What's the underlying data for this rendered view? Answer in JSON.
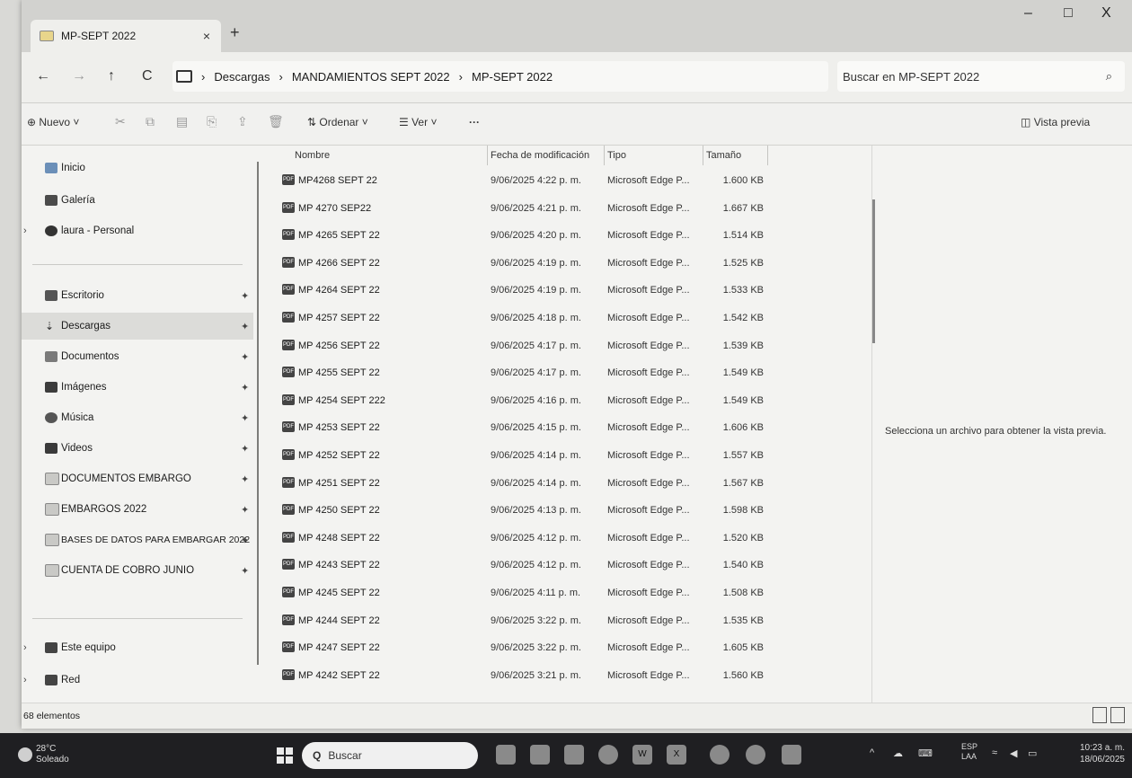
{
  "window": {
    "tab_title": "MP-SEPT 2022",
    "tab_close": "×",
    "new_tab": "+",
    "minimize": "–",
    "maximize": "□",
    "close": "X"
  },
  "nav": {
    "back": "←",
    "forward": "→",
    "up": "↑",
    "refresh": "C"
  },
  "address": {
    "crumbs": [
      "Descargas",
      "MANDAMIENTOS SEPT 2022",
      "MP-SEPT 2022"
    ],
    "sep": "›",
    "search_placeholder": "Buscar en MP-SEPT 2022"
  },
  "cmdbar": {
    "new_label": "Nuevo",
    "sort_label": "Ordenar",
    "view_label": "Ver",
    "more": "···",
    "preview_label": "Vista previa"
  },
  "sidebar": {
    "top": [
      {
        "label": "Inicio",
        "icon": "home-icon"
      },
      {
        "label": "Galería",
        "icon": "gallery-icon"
      },
      {
        "label": "laura - Personal",
        "icon": "cloud-icon"
      }
    ],
    "quick": [
      {
        "label": "Escritorio",
        "icon": "desktop-icon"
      },
      {
        "label": "Descargas",
        "icon": "download-icon",
        "selected": true
      },
      {
        "label": "Documentos",
        "icon": "documents-icon"
      },
      {
        "label": "Imágenes",
        "icon": "pictures-icon"
      },
      {
        "label": "Música",
        "icon": "music-icon"
      },
      {
        "label": "Videos",
        "icon": "videos-icon"
      },
      {
        "label": "DOCUMENTOS EMBARGO",
        "icon": "folder-icon"
      },
      {
        "label": "EMBARGOS 2022",
        "icon": "folder-icon"
      },
      {
        "label": "BASES DE DATOS PARA EMBARGAR 2022",
        "icon": "folder-icon"
      },
      {
        "label": "CUENTA DE COBRO JUNIO",
        "icon": "folder-icon"
      }
    ],
    "bottom": [
      {
        "label": "Este equipo",
        "icon": "computer-icon"
      },
      {
        "label": "Red",
        "icon": "network-icon"
      }
    ]
  },
  "columns": {
    "name": "Nombre",
    "date": "Fecha de modificación",
    "type": "Tipo",
    "size": "Tamaño"
  },
  "files": [
    {
      "name": "MP4268 SEPT 22",
      "date": "9/06/2025 4:22 p. m.",
      "type": "Microsoft Edge P...",
      "size": "1.600 KB"
    },
    {
      "name": "MP 4270 SEP22",
      "date": "9/06/2025 4:21 p. m.",
      "type": "Microsoft Edge P...",
      "size": "1.667 KB"
    },
    {
      "name": "MP 4265 SEPT 22",
      "date": "9/06/2025 4:20 p. m.",
      "type": "Microsoft Edge P...",
      "size": "1.514 KB"
    },
    {
      "name": "MP 4266 SEPT 22",
      "date": "9/06/2025 4:19 p. m.",
      "type": "Microsoft Edge P...",
      "size": "1.525 KB"
    },
    {
      "name": "MP 4264 SEPT 22",
      "date": "9/06/2025 4:19 p. m.",
      "type": "Microsoft Edge P...",
      "size": "1.533 KB"
    },
    {
      "name": "MP 4257 SEPT 22",
      "date": "9/06/2025 4:18 p. m.",
      "type": "Microsoft Edge P...",
      "size": "1.542 KB"
    },
    {
      "name": "MP 4256 SEPT 22",
      "date": "9/06/2025 4:17 p. m.",
      "type": "Microsoft Edge P...",
      "size": "1.539 KB"
    },
    {
      "name": "MP 4255 SEPT 22",
      "date": "9/06/2025 4:17 p. m.",
      "type": "Microsoft Edge P...",
      "size": "1.549 KB"
    },
    {
      "name": "MP 4254 SEPT 222",
      "date": "9/06/2025 4:16 p. m.",
      "type": "Microsoft Edge P...",
      "size": "1.549 KB"
    },
    {
      "name": "MP 4253 SEPT 22",
      "date": "9/06/2025 4:15 p. m.",
      "type": "Microsoft Edge P...",
      "size": "1.606 KB"
    },
    {
      "name": "MP 4252 SEPT 22",
      "date": "9/06/2025 4:14 p. m.",
      "type": "Microsoft Edge P...",
      "size": "1.557 KB"
    },
    {
      "name": "MP 4251 SEPT 22",
      "date": "9/06/2025 4:14 p. m.",
      "type": "Microsoft Edge P...",
      "size": "1.567 KB"
    },
    {
      "name": "MP 4250 SEPT 22",
      "date": "9/06/2025 4:13 p. m.",
      "type": "Microsoft Edge P...",
      "size": "1.598 KB"
    },
    {
      "name": "MP 4248 SEPT 22",
      "date": "9/06/2025 4:12 p. m.",
      "type": "Microsoft Edge P...",
      "size": "1.520 KB"
    },
    {
      "name": "MP 4243 SEPT 22",
      "date": "9/06/2025 4:12 p. m.",
      "type": "Microsoft Edge P...",
      "size": "1.540 KB"
    },
    {
      "name": "MP 4245 SEPT 22",
      "date": "9/06/2025 4:11 p. m.",
      "type": "Microsoft Edge P...",
      "size": "1.508 KB"
    },
    {
      "name": "MP 4244 SEPT 22",
      "date": "9/06/2025 3:22 p. m.",
      "type": "Microsoft Edge P...",
      "size": "1.535 KB"
    },
    {
      "name": "MP 4247 SEPT 22",
      "date": "9/06/2025 3:22 p. m.",
      "type": "Microsoft Edge P...",
      "size": "1.605 KB"
    },
    {
      "name": "MP 4242 SEPT 22",
      "date": "9/06/2025 3:21 p. m.",
      "type": "Microsoft Edge P...",
      "size": "1.560 KB"
    }
  ],
  "preview": {
    "message": "Selecciona un archivo para obtener la vista previa."
  },
  "status": {
    "count": "68 elementos"
  },
  "taskbar": {
    "temp": "28°C",
    "weather": "Soleado",
    "search": "Buscar",
    "lang1": "ESP",
    "lang2": "LAA",
    "time": "10:23 a. m.",
    "date": "18/06/2025"
  }
}
